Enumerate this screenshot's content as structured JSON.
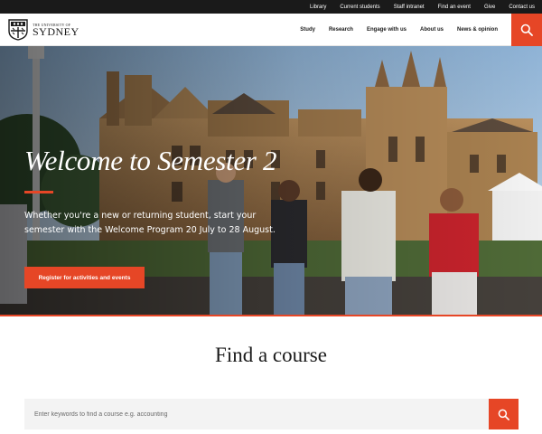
{
  "utility_nav": [
    "Library",
    "Current students",
    "Staff intranet",
    "Find an event",
    "Give",
    "Contact us"
  ],
  "logo": {
    "line1": "THE UNIVERSITY OF",
    "line2": "SYDNEY"
  },
  "main_nav": [
    "Study",
    "Research",
    "Engage with us",
    "About us",
    "News & opinion"
  ],
  "hero": {
    "title": "Welcome to Semester 2",
    "copy": "Whether you're a new or returning student, start your semester with the Welcome Program 20 July to 28 August.",
    "cta": "Register for activities and events"
  },
  "find_course": {
    "title": "Find a course",
    "placeholder": "Enter keywords to find a course e.g. accounting"
  },
  "colors": {
    "accent": "#e64626",
    "utility_bg": "#1a1a1a"
  },
  "icons": {
    "search": "search-icon",
    "crest": "crest-icon"
  }
}
